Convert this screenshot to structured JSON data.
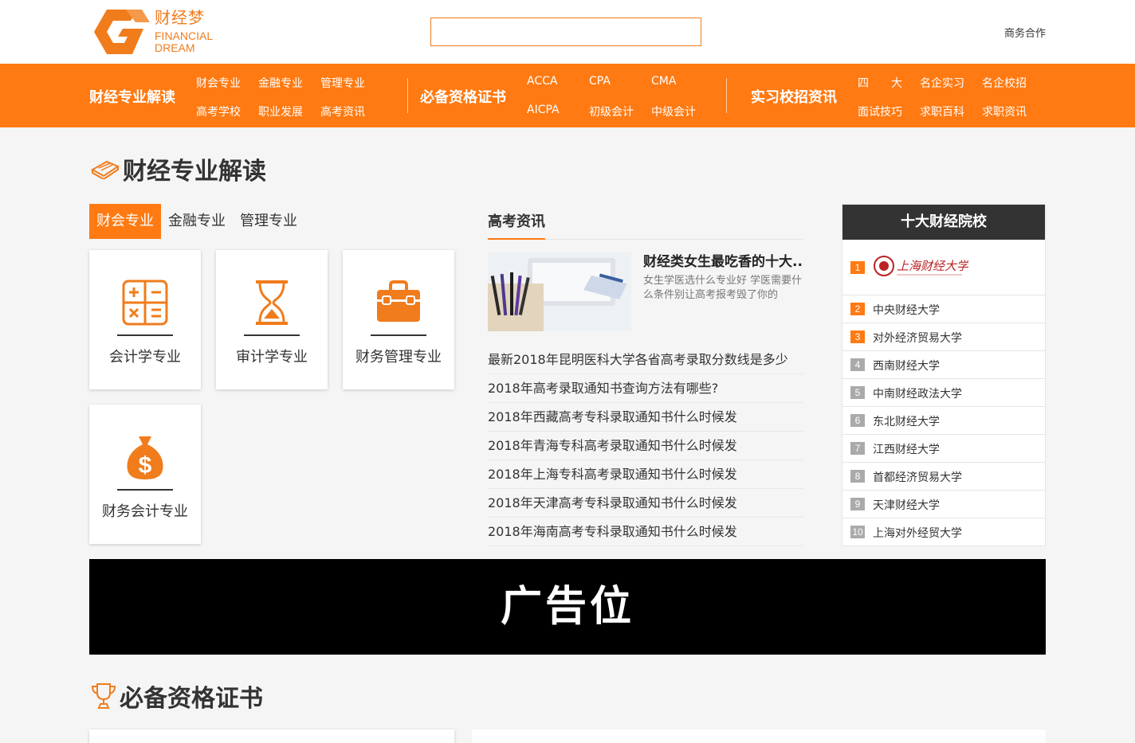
{
  "header": {
    "logo_cn": "财经梦",
    "logo_en_1": "FINANCIAL",
    "logo_en_2": "DREAM",
    "search_placeholder": "",
    "biz_link": "商务合作"
  },
  "nav": {
    "group1": {
      "title": "财经专业解读",
      "links": [
        "财会专业",
        "金融专业",
        "管理专业",
        "高考学校",
        "职业发展",
        "高考资讯"
      ]
    },
    "group2": {
      "title": "必备资格证书",
      "links": [
        "ACCA",
        "CPA",
        "CMA",
        "AICPA",
        "初级会计",
        "中级会计"
      ]
    },
    "group3": {
      "title": "实习校招资讯",
      "links": [
        "四　　大",
        "名企实习",
        "名企校招",
        "面试技巧",
        "求职百科",
        "求职资讯"
      ]
    }
  },
  "section1": {
    "title": "财经专业解读",
    "tabs": [
      "财会专业",
      "金融专业",
      "管理专业"
    ],
    "cards": [
      {
        "label": "会计学专业",
        "icon": "calculator-icon"
      },
      {
        "label": "审计学专业",
        "icon": "hourglass-icon"
      },
      {
        "label": "财务管理专业",
        "icon": "briefcase-icon"
      },
      {
        "label": "财务会计专业",
        "icon": "money-bag-icon"
      }
    ]
  },
  "news": {
    "heading": "高考资讯",
    "featured": {
      "title": "财经类女生最吃香的十大...",
      "desc": "女生学医选什么专业好 学医需要什么条件别让高考报考毁了你的"
    },
    "items": [
      "最新2018年昆明医科大学各省高考录取分数线是多少",
      "2018年高考录取通知书查询方法有哪些?",
      "2018年西藏高考专科录取通知书什么时候发",
      "2018年青海专科高考录取通知书什么时候发",
      "2018年上海专科高考录取通知书什么时候发",
      "2018年天津高考专科录取通知书什么时候发",
      "2018年海南高考专科录取通知书什么时候发"
    ]
  },
  "ranking": {
    "title": "十大财经院校",
    "first_number": "1",
    "first_logo_text": "上海财经大学",
    "rows": [
      {
        "num": "2",
        "name": "中央财经大学"
      },
      {
        "num": "3",
        "name": "对外经济贸易大学"
      },
      {
        "num": "4",
        "name": "西南财经大学"
      },
      {
        "num": "5",
        "name": "中南财经政法大学"
      },
      {
        "num": "6",
        "name": "东北财经大学"
      },
      {
        "num": "7",
        "name": "江西财经大学"
      },
      {
        "num": "8",
        "name": "首都经济贸易大学"
      },
      {
        "num": "9",
        "name": "天津财经大学"
      },
      {
        "num": "10",
        "name": "上海对外经贸大学"
      }
    ]
  },
  "ad": {
    "label": "广告位"
  },
  "section2": {
    "title": "必备资格证书"
  },
  "colors": {
    "accent": "#ff7a12",
    "dark": "#333333"
  }
}
